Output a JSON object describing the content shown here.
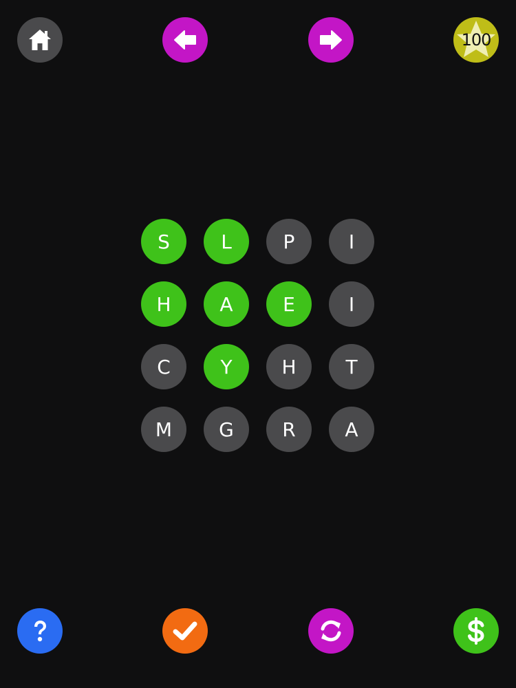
{
  "header": {
    "home_icon": "home-icon",
    "prev_icon": "arrow-left-icon",
    "next_icon": "arrow-right-icon",
    "score_icon": "star-icon",
    "score": "100"
  },
  "grid": {
    "rows": [
      [
        "S",
        "L",
        "P",
        "I"
      ],
      [
        "H",
        "A",
        "E",
        "I"
      ],
      [
        "C",
        "Y",
        "H",
        "T"
      ],
      [
        "M",
        "G",
        "R",
        "A"
      ]
    ],
    "selected": [
      [
        true,
        true,
        false,
        false
      ],
      [
        true,
        true,
        true,
        false
      ],
      [
        false,
        true,
        false,
        false
      ],
      [
        false,
        false,
        false,
        false
      ]
    ]
  },
  "footer": {
    "help_icon": "question-mark-icon",
    "check_icon": "checkmark-icon",
    "shuffle_icon": "refresh-icon",
    "shop_icon": "dollar-icon"
  },
  "colors": {
    "background": "#0f0f10",
    "tile_default": "#4a4a4c",
    "tile_selected": "#3fc21a",
    "nav_magenta": "#c316c6",
    "score_yellow": "#bfbd18",
    "help_blue": "#2a6cf2",
    "check_orange": "#f26b12",
    "shop_green": "#3fc21a"
  }
}
